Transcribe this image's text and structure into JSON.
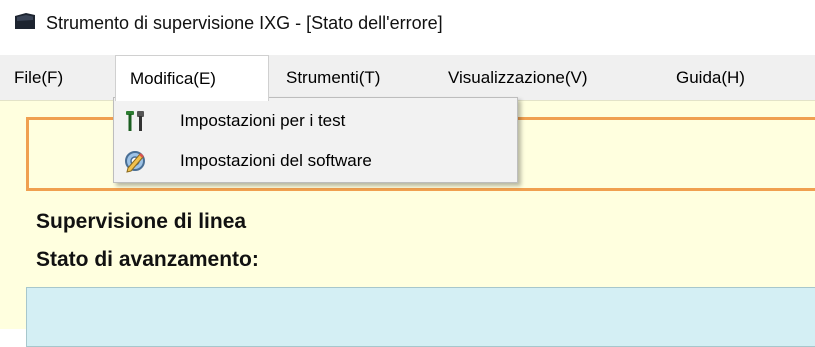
{
  "window": {
    "title": "Strumento di supervisione IXG - [Stato dell'errore]",
    "app_icon": "app-window-icon"
  },
  "menubar": {
    "items": [
      {
        "label": "File(F)"
      },
      {
        "label": "Modifica(E)",
        "open": true
      },
      {
        "label": "Strumenti(T)"
      },
      {
        "label": "Visualizzazione(V)"
      },
      {
        "label": "Guida(H)"
      }
    ]
  },
  "dropdown": {
    "items": [
      {
        "label": "Impostazioni per i test",
        "icon": "tools-icon"
      },
      {
        "label": "Impostazioni del software",
        "icon": "settings-pencil-icon"
      }
    ]
  },
  "content": {
    "line_supervision": "Supervisione di linea",
    "progress_status": "Stato di avanzamento:"
  },
  "colors": {
    "content_bg": "#ffffdf",
    "panel_border": "#f0a050",
    "status_panel_bg": "#d4eff4",
    "menubar_bg": "#f0f0f0"
  }
}
